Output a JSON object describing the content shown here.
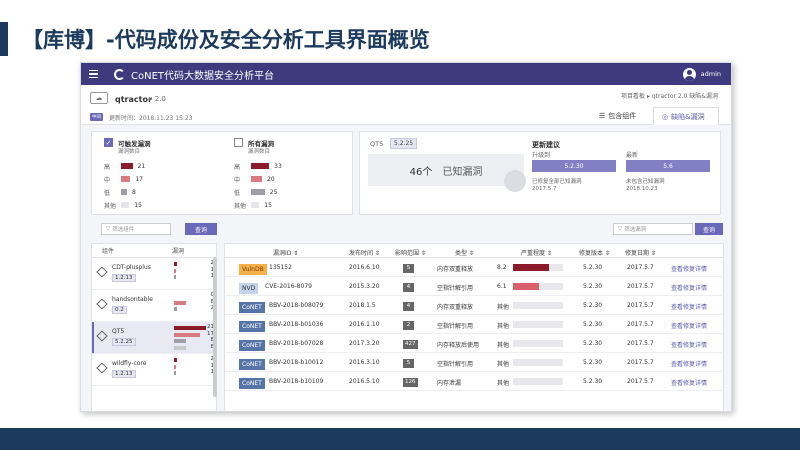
{
  "slide": {
    "title": "【库博】-代码成份及安全分析工具界面概览"
  },
  "app": {
    "title": "CoNET代码大数据安全分析平台",
    "user": "admin"
  },
  "project": {
    "name": "qtractor",
    "version": "2.0",
    "badge": "中间",
    "updated": "更新时间：2018.11.23  15:23",
    "breadcrumb": "项目看板  ▸  qtractor 2.0 缺陷&漏洞",
    "tabs": {
      "deps": "包含组件",
      "vulns": "缺陷&漏洞"
    }
  },
  "filters": {
    "reachable": {
      "label": "可触发漏洞",
      "sub": "漏洞数目",
      "checked": true,
      "rows": [
        {
          "label": "高",
          "count": "21",
          "color": "#8b1a2b"
        },
        {
          "label": "中",
          "count": "17",
          "color": "#d87a80"
        },
        {
          "label": "低",
          "count": "8",
          "color": "#9e9ea8"
        },
        {
          "label": "其他",
          "count": "15",
          "color": "#e6e6ea"
        }
      ]
    },
    "all": {
      "label": "所有漏洞",
      "sub": "漏洞数目",
      "checked": false,
      "rows": [
        {
          "label": "高",
          "count": "33",
          "color": "#8b1a2b"
        },
        {
          "label": "中",
          "count": "20",
          "color": "#d87a80"
        },
        {
          "label": "低",
          "count": "25",
          "color": "#9e9ea8"
        },
        {
          "label": "其他",
          "count": "15",
          "color": "#e6e6ea"
        }
      ]
    }
  },
  "summary": {
    "component": "QT5",
    "version": "5.2.25",
    "known_count": "46个",
    "known_text": "已知漏洞",
    "update_title": "更新建议",
    "upgrade_label": "升级到",
    "upgrade_version": "5.2.30",
    "upgrade_note1": "已修复全部已知漏洞",
    "upgrade_note2": "2017.5.7",
    "latest_label": "最新",
    "latest_version": "5.6",
    "latest_note1": "未包含已知漏洞",
    "latest_note2": "2018.10.23"
  },
  "search_left": {
    "placeholder": "筛选组件",
    "button": "查询"
  },
  "search_right": {
    "placeholder": "筛选漏洞",
    "button": "查询"
  },
  "components": {
    "header_name": "组件",
    "header_vuln": "漏洞",
    "items": [
      {
        "name": "CDT-plusplus",
        "version": "1.2.13",
        "counts": [
          "2",
          "1",
          "1"
        ],
        "selected": false
      },
      {
        "name": "handsontable",
        "version": "0.2",
        "counts": [
          "0",
          "8",
          "2"
        ],
        "selected": false
      },
      {
        "name": "QT5",
        "version": "5.2.25",
        "counts": [
          "21",
          "17",
          "8",
          "8"
        ],
        "selected": true
      },
      {
        "name": "wildfly-core",
        "version": "1.2.13",
        "counts": [
          "2",
          "1",
          "1"
        ],
        "selected": false
      }
    ]
  },
  "vuln_table": {
    "headers": {
      "id": "漏洞ID ⇕",
      "date": "发布时间 ⇕",
      "impact": "影响范围 ⇕",
      "type": "类型 ⇕",
      "severity": "严重程度 ⇕",
      "fixver": "修复版本 ⇕",
      "fixdate": "修复日期 ⇕"
    },
    "rows": [
      {
        "source": "VulnDB",
        "src_class": "vdb",
        "id": "135152",
        "date": "2016.6.10",
        "impact": "5",
        "type": "内存双重释放",
        "score": "8.2",
        "sev": 0.72,
        "sev_color": "#8b1a2b",
        "fixver": "5.2.30",
        "fixdate": "2017.5.7",
        "action": "查看修复详情"
      },
      {
        "source": "NVD",
        "src_class": "nvd",
        "id": "CVE-2016-8079",
        "date": "2015.3.20",
        "impact": "4",
        "type": "空指针解引用",
        "score": "6.1",
        "sev": 0.52,
        "sev_color": "#d9606a",
        "fixver": "5.2.30",
        "fixdate": "2017.5.7",
        "action": "查看修复详情"
      },
      {
        "source": "CoNET",
        "src_class": "cnet",
        "id": "BBV-2018-b08079",
        "date": "2018.1.5",
        "impact": "4",
        "type": "内存双重释放",
        "score": "其他",
        "sev": 0,
        "sev_color": "#e8e8ec",
        "fixver": "5.2.30",
        "fixdate": "2017.5.7",
        "action": "查看修复详情"
      },
      {
        "source": "CoNET",
        "src_class": "cnet",
        "id": "BBV-2018-b01036",
        "date": "2016.1.10",
        "impact": "2",
        "type": "空指针解引用",
        "score": "其他",
        "sev": 0,
        "sev_color": "#e8e8ec",
        "fixver": "5.2.30",
        "fixdate": "2017.5.7",
        "action": "查看修复详情"
      },
      {
        "source": "CoNET",
        "src_class": "cnet",
        "id": "BBV-2018-b07028",
        "date": "2017.3.20",
        "impact": "427",
        "type": "内存释放后使用",
        "score": "其他",
        "sev": 0,
        "sev_color": "#e8e8ec",
        "fixver": "5.2.30",
        "fixdate": "2017.5.7",
        "action": "查看修复详情"
      },
      {
        "source": "CoNET",
        "src_class": "cnet",
        "id": "BBV-2018-b10012",
        "date": "2016.3.10",
        "impact": "5",
        "type": "空指针解引用",
        "score": "其他",
        "sev": 0,
        "sev_color": "#e8e8ec",
        "fixver": "5.2.30",
        "fixdate": "2017.5.7",
        "action": "查看修复详情"
      },
      {
        "source": "CoNET",
        "src_class": "cnet",
        "id": "BBV-2018-b10109",
        "date": "2016.5.10",
        "impact": "126",
        "type": "内存泄漏",
        "score": "其他",
        "sev": 0,
        "sev_color": "#e8e8ec",
        "fixver": "5.2.30",
        "fixdate": "2017.5.7",
        "action": "查看修复详情"
      }
    ]
  },
  "colors": {
    "brand": "#3d3b7e",
    "accent": "#6a68b8",
    "slide_navy": "#1b3a5c",
    "high": "#8b1a2b",
    "medium": "#d87a80",
    "low": "#9e9ea8",
    "other": "#e6e6ea"
  }
}
